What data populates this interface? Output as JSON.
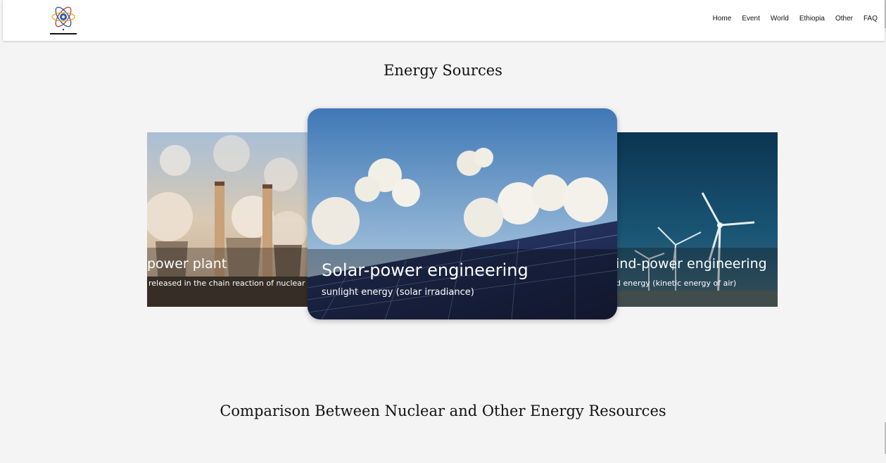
{
  "nav": {
    "links": [
      "Home",
      "Event",
      "World",
      "Ethiopia",
      "Other",
      "FAQ"
    ]
  },
  "energy_section": {
    "title": "Energy Sources",
    "cards": [
      {
        "title": "power plant",
        "subtitle": "released in the chain reaction of nuclear f"
      },
      {
        "title": "Solar-power engineering",
        "subtitle": "sunlight energy (solar irradiance)"
      },
      {
        "title": "ind-power engineering",
        "subtitle": "d energy (kinetic energy of air)"
      }
    ]
  },
  "comparison_section": {
    "title": "Comparison Between Nuclear and Other Energy Resources"
  }
}
